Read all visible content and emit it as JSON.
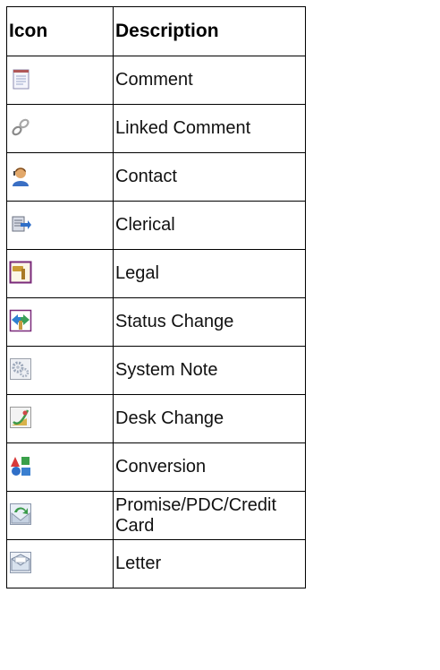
{
  "table": {
    "headers": {
      "icon": "Icon",
      "description": "Description"
    },
    "rows": [
      {
        "icon": "comment-icon",
        "label": "Comment"
      },
      {
        "icon": "linked-comment-icon",
        "label": "Linked Comment"
      },
      {
        "icon": "contact-icon",
        "label": "Contact"
      },
      {
        "icon": "clerical-icon",
        "label": "Clerical"
      },
      {
        "icon": "legal-icon",
        "label": "Legal"
      },
      {
        "icon": "status-change-icon",
        "label": "Status Change"
      },
      {
        "icon": "system-note-icon",
        "label": "System Note"
      },
      {
        "icon": "desk-change-icon",
        "label": "Desk Change"
      },
      {
        "icon": "conversion-icon",
        "label": "Conversion"
      },
      {
        "icon": "promise-pdc-credit-card-icon",
        "label": "Promise/PDC/Credit Card"
      },
      {
        "icon": "letter-icon",
        "label": "Letter"
      }
    ]
  }
}
